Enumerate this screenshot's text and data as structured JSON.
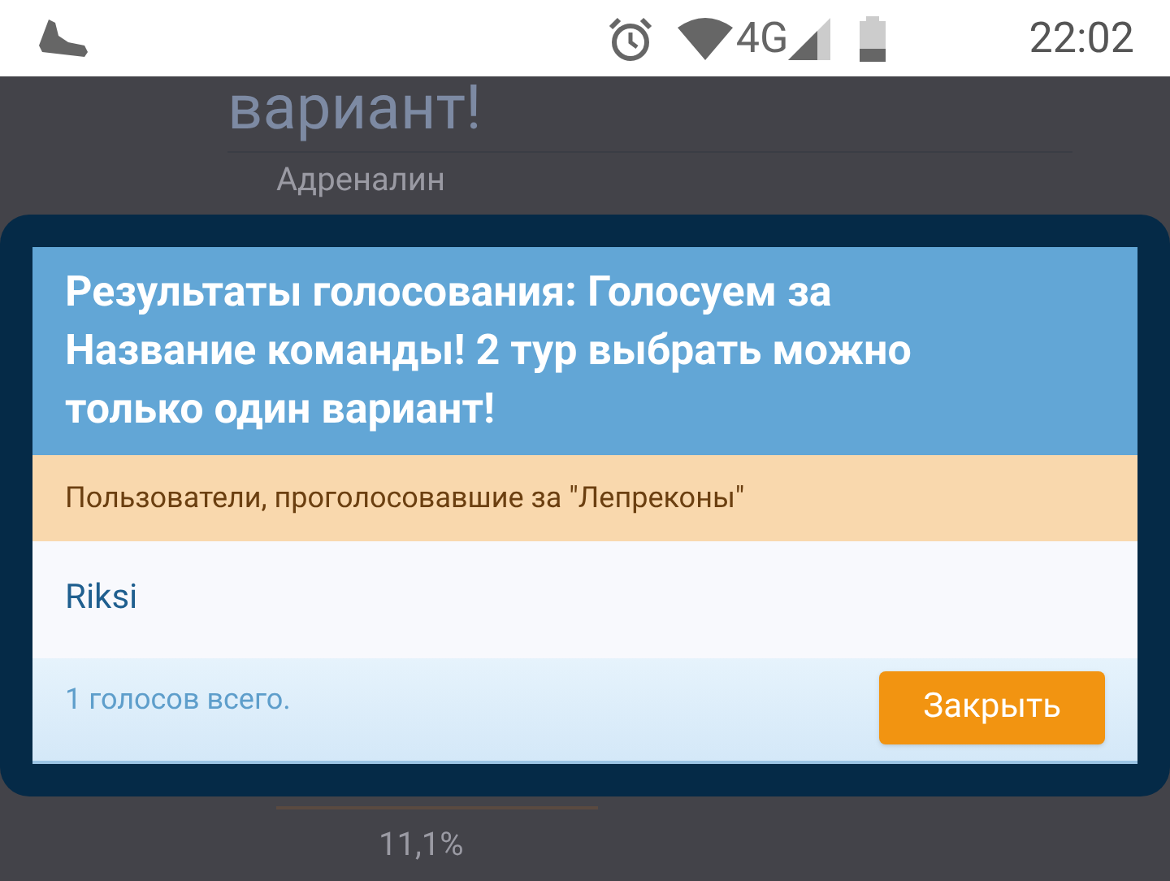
{
  "status_bar": {
    "time": "22:02",
    "network": "4G"
  },
  "background": {
    "heading": "вариант!",
    "option": "Адреналин",
    "percent": "11,1%"
  },
  "dialog": {
    "title": "Результаты голосования: Голосуем за Название команды! 2 тур выбрать можно только один вариант!",
    "subtitle": "Пользователи, проголосовавшие за \"Лепреконы\"",
    "voters": [
      "Riksi"
    ],
    "total": "1 голосов всего.",
    "close_button": "Закрыть"
  }
}
